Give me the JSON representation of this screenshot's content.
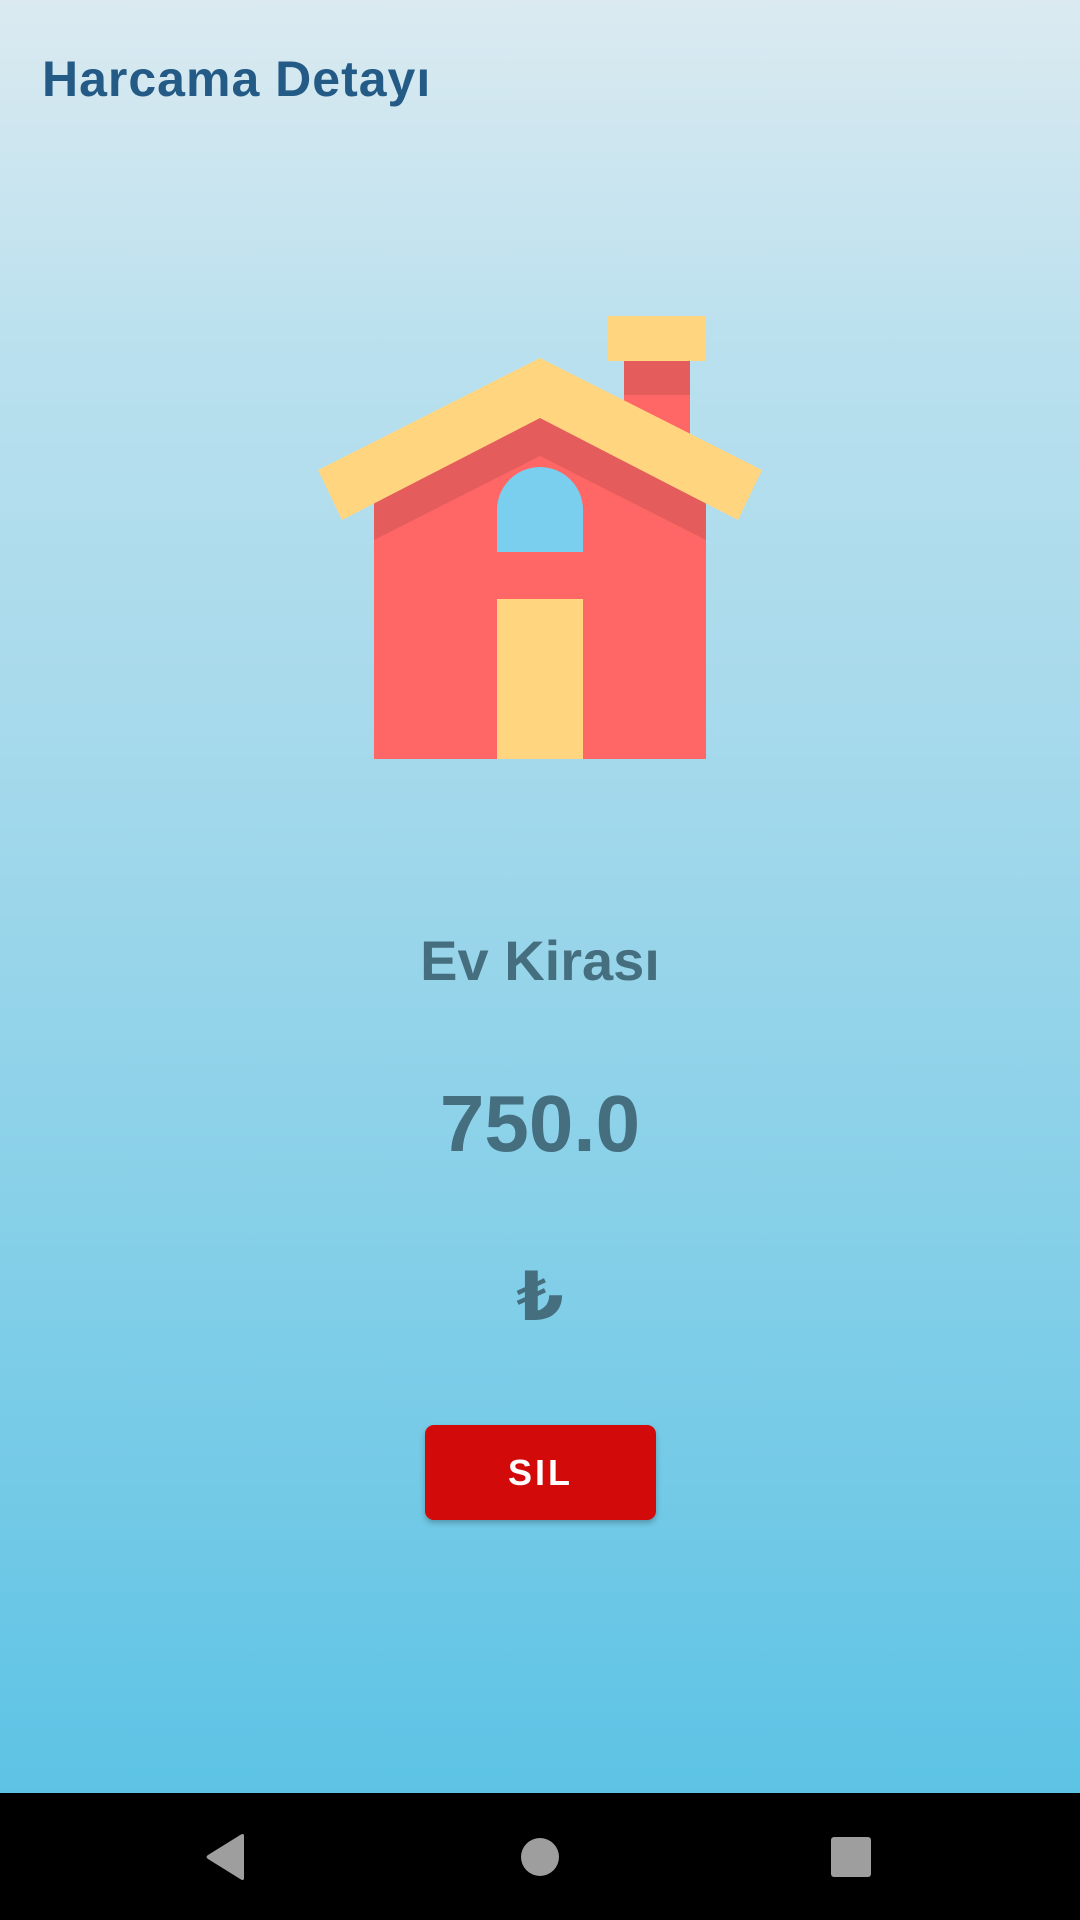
{
  "header": {
    "title": "Harcama Detayı"
  },
  "expense": {
    "icon": "house-icon",
    "category": "Ev Kirası",
    "amount": "750.0",
    "currency_symbol": "₺"
  },
  "actions": {
    "delete_label": "SIL"
  },
  "colors": {
    "title": "#245b86",
    "text": "#456e7f",
    "delete_button": "#d20a0a",
    "house_wall": "#ff6666",
    "house_roof": "#ffd580",
    "house_window": "#79cfed",
    "background_top": "#dbeaf1",
    "background_bottom": "#5dc3e5"
  },
  "system_nav": {
    "back": "back-icon",
    "home": "home-icon",
    "recents": "recents-icon"
  }
}
